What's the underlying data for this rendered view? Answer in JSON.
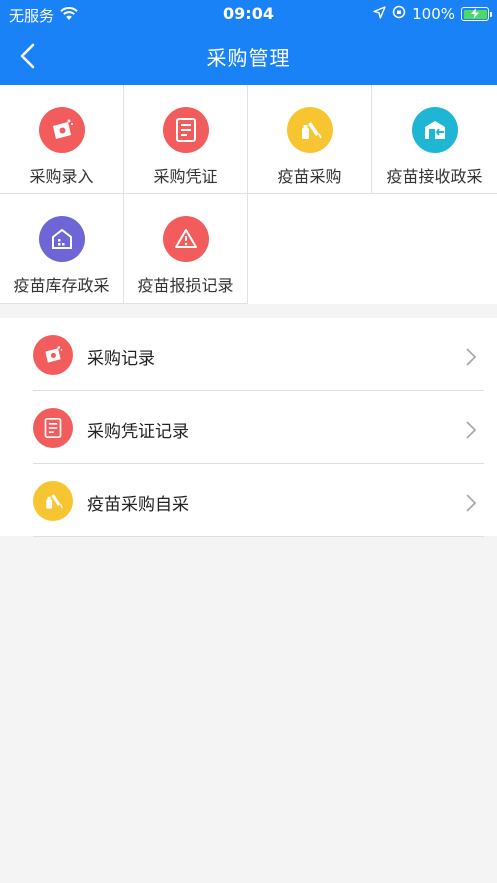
{
  "status_bar": {
    "carrier": "无服务",
    "time": "09:04",
    "battery": "100%"
  },
  "nav": {
    "title": "采购管理"
  },
  "grid": [
    {
      "label": "采购录入",
      "icon": "purchase-entry-icon",
      "color": "#f25c5c"
    },
    {
      "label": "采购凭证",
      "icon": "document-icon",
      "color": "#f25c5c"
    },
    {
      "label": "疫苗采购",
      "icon": "vaccine-icon",
      "color": "#f7c531"
    },
    {
      "label": "疫苗接收政采",
      "icon": "warehouse-receive-icon",
      "color": "#1fb6d3"
    },
    {
      "label": "疫苗库存政采",
      "icon": "building-icon",
      "color": "#6e66d6"
    },
    {
      "label": "疫苗报损记录",
      "icon": "warning-icon",
      "color": "#f25c5c"
    }
  ],
  "list": [
    {
      "label": "采购记录",
      "icon": "purchase-entry-icon",
      "color": "#f25c5c"
    },
    {
      "label": "采购凭证记录",
      "icon": "document-icon",
      "color": "#f25c5c"
    },
    {
      "label": "疫苗采购自采",
      "icon": "vaccine-icon",
      "color": "#f7c531"
    }
  ]
}
